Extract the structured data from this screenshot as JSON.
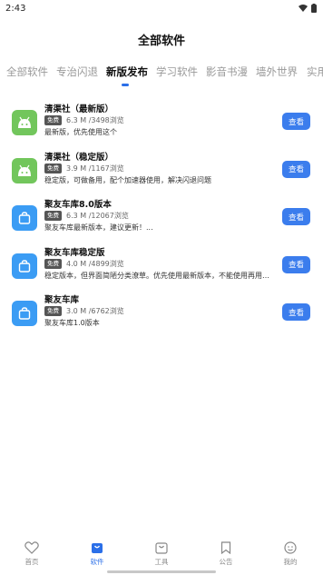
{
  "status_bar": {
    "time": "2:43"
  },
  "header": {
    "title": "全部软件"
  },
  "tabs": [
    {
      "label": "全部软件",
      "active": false
    },
    {
      "label": "专治闪退",
      "active": false
    },
    {
      "label": "新版发布",
      "active": true
    },
    {
      "label": "学习软件",
      "active": false
    },
    {
      "label": "影音书漫",
      "active": false
    },
    {
      "label": "墙外世界",
      "active": false
    },
    {
      "label": "实用",
      "active": false
    }
  ],
  "apps": [
    {
      "title": "清渠社（最新版）",
      "badge": "免费",
      "stats": "6.3 M /3498浏览",
      "desc": "最新版，优先使用这个",
      "icon": "android-icon",
      "button": "查看"
    },
    {
      "title": "清渠社（稳定版）",
      "badge": "免费",
      "stats": "3.9 M /1167浏览",
      "desc": "稳定版，可做备用，配个加速器使用，解决闪退问题",
      "icon": "android-icon",
      "button": "查看"
    },
    {
      "title": "聚友车库8.0版本",
      "badge": "免费",
      "stats": "6.3 M /12067浏览",
      "desc": "聚友车库最新版本，建议更新！...",
      "icon": "bag-icon",
      "button": "查看"
    },
    {
      "title": "聚友车库稳定版",
      "badge": "免费",
      "stats": "4.0 M /4899浏览",
      "desc": "稳定版本，但界面简陋分类潦草。优先使用最新版本，不能使用再用这...",
      "icon": "bag-icon",
      "button": "查看"
    },
    {
      "title": "聚友车库",
      "badge": "免费",
      "stats": "3.0 M /6762浏览",
      "desc": "聚友车库1.0版本",
      "icon": "bag-icon",
      "button": "查看"
    }
  ],
  "bottom_nav": [
    {
      "label": "首页",
      "icon": "heart-icon",
      "active": false
    },
    {
      "label": "软件",
      "icon": "bag-icon",
      "active": true
    },
    {
      "label": "工具",
      "icon": "tool-bag-icon",
      "active": false
    },
    {
      "label": "公告",
      "icon": "bookmark-icon",
      "active": false
    },
    {
      "label": "我的",
      "icon": "smiley-icon",
      "active": false
    }
  ],
  "colors": {
    "accent": "#3b7ded",
    "android_green": "#72c65c",
    "bag_blue": "#3b9cf4"
  }
}
